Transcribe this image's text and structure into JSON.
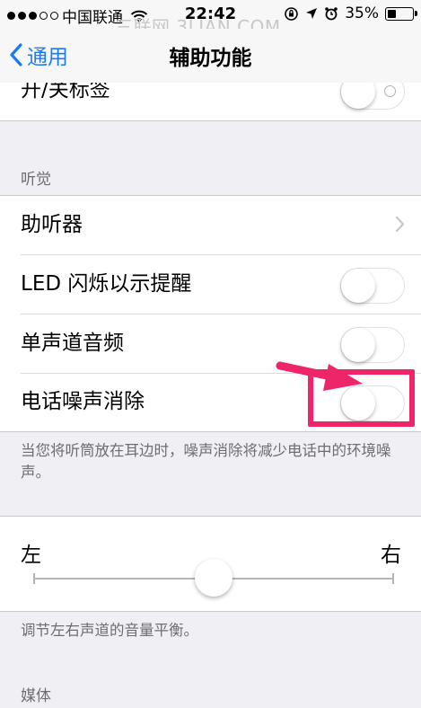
{
  "status_bar": {
    "carrier": "中国联通",
    "time": "22:42",
    "watermark": "三联网 3LIAN.COM",
    "battery": "35%"
  },
  "nav": {
    "back_label": "通用",
    "title": "辅助功能"
  },
  "top_cell": {
    "label": "开/关标签",
    "toggle_on": false
  },
  "hearing": {
    "header": "听觉",
    "items": [
      {
        "label": "助听器",
        "type": "disclosure"
      },
      {
        "label": "LED 闪烁以示提醒",
        "type": "toggle",
        "on": false
      },
      {
        "label": "单声道音频",
        "type": "toggle",
        "on": false
      },
      {
        "label": "电话噪声消除",
        "type": "toggle",
        "on": false
      }
    ],
    "footer": "当您将听筒放在耳边时，噪声消除将减少电话中的环境噪声。"
  },
  "balance": {
    "left_label": "左",
    "right_label": "右",
    "value": 0.5,
    "footer": "调节左右声道的音量平衡。"
  },
  "media": {
    "header": "媒体"
  },
  "annotation": {
    "color": "#ee2568"
  },
  "colors": {
    "accent": "#1a7cf5",
    "background": "#efeff4"
  }
}
